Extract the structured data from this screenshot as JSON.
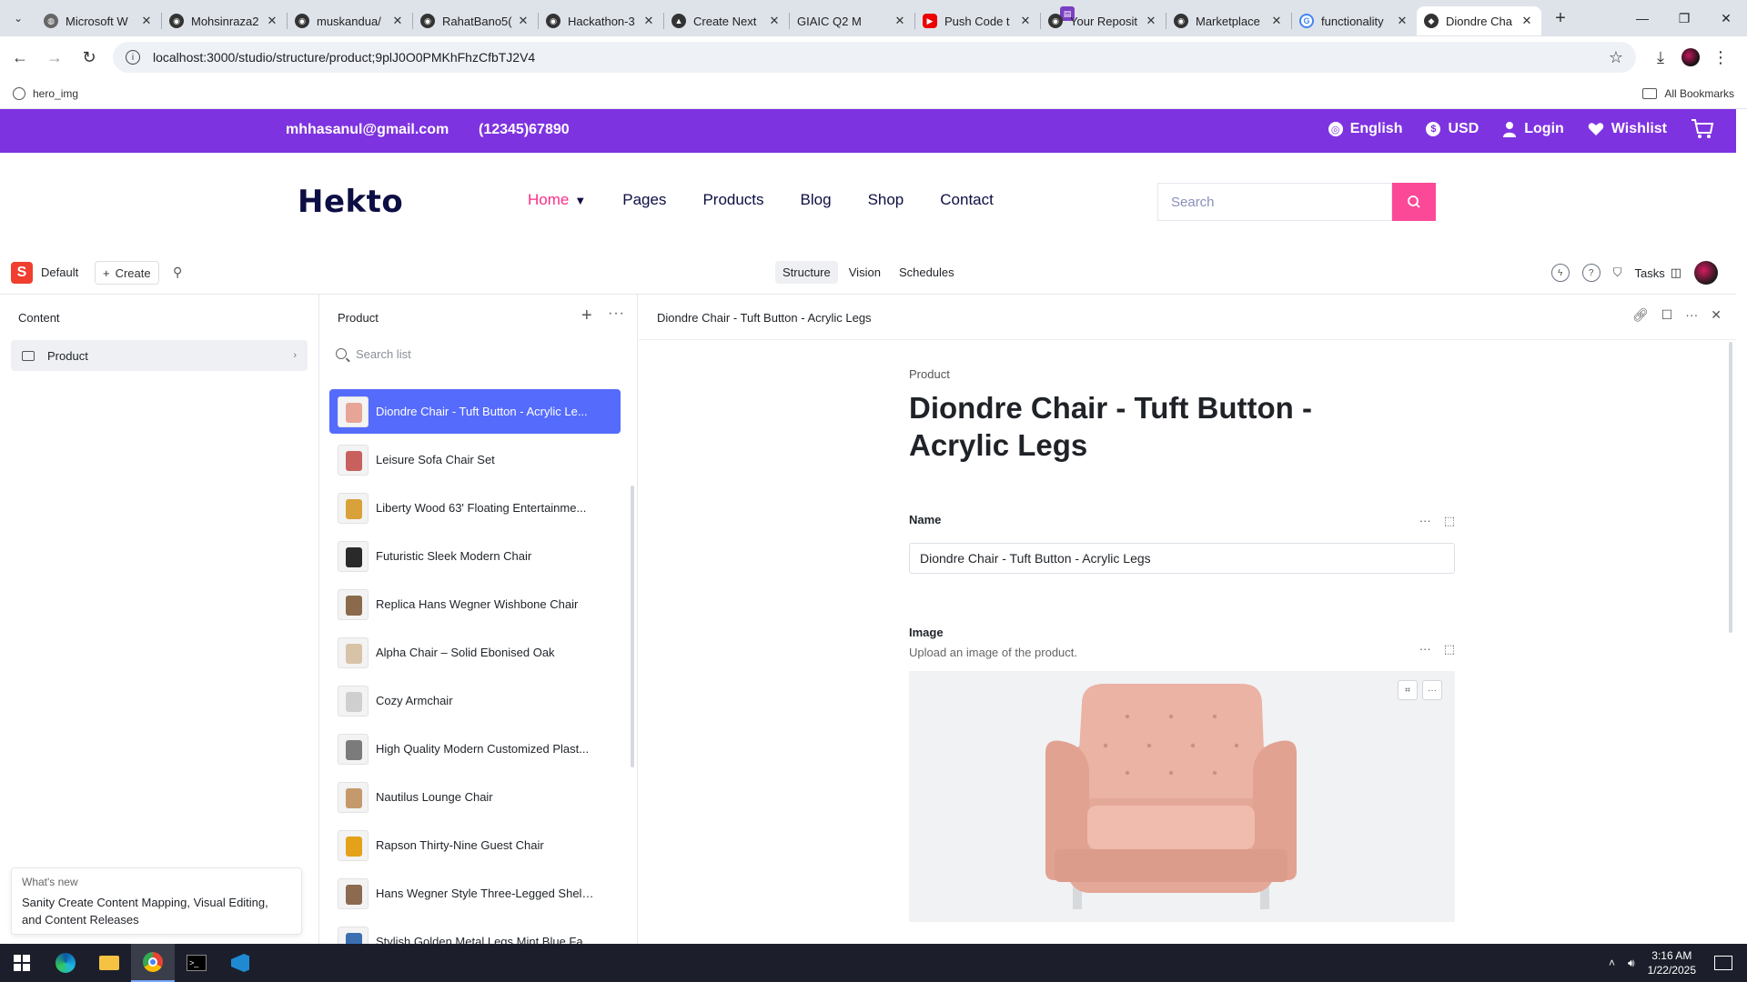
{
  "browser": {
    "tabs": [
      {
        "title": "Microsoft W",
        "icon": "microsoft-icon"
      },
      {
        "title": "Mohsinraza2",
        "icon": "github-icon"
      },
      {
        "title": "muskandua/",
        "icon": "github-icon"
      },
      {
        "title": "RahatBano5(",
        "icon": "github-icon"
      },
      {
        "title": "Hackathon-3",
        "icon": "github-icon"
      },
      {
        "title": "Create Next",
        "icon": "nextjs-icon"
      },
      {
        "title": "GIAIC Q2 M",
        "icon": "doc-icon"
      },
      {
        "title": "Push Code t",
        "icon": "youtube-icon"
      },
      {
        "title": "Your Reposit",
        "icon": "github-icon"
      },
      {
        "title": "Marketplace",
        "icon": "github-icon"
      },
      {
        "title": "functionality",
        "icon": "google-icon"
      },
      {
        "title": "Diondre Cha",
        "icon": "sanity-icon",
        "active": true
      }
    ],
    "url": "localhost:3000/studio/structure/product;9plJ0O0PMKhFhzCfbTJ2V4",
    "bookmark": "hero_img",
    "all_bookmarks": "All Bookmarks"
  },
  "site": {
    "email": "mhhasanul@gmail.com",
    "phone": "(12345)67890",
    "language": "English",
    "currency": "USD",
    "login": "Login",
    "wishlist": "Wishlist",
    "logo": "Hekto",
    "nav": {
      "home": "Home",
      "pages": "Pages",
      "products": "Products",
      "blog": "Blog",
      "shop": "Shop",
      "contact": "Contact"
    },
    "search_placeholder": "Search",
    "accent": "#7E33E0",
    "pink": "#FB2E86"
  },
  "studio": {
    "workspace": "Default",
    "create": "Create",
    "tabs": {
      "structure": "Structure",
      "vision": "Vision",
      "schedules": "Schedules"
    },
    "tasks": "Tasks",
    "content_title": "Content",
    "content_item": "Product",
    "list_title": "Product",
    "list_search": "Search list",
    "list": [
      "Diondre Chair - Tuft Button - Acrylic Le...",
      "Leisure Sofa Chair Set",
      "Liberty Wood 63' Floating Entertainme...",
      "Futuristic Sleek Modern Chair",
      "Replica Hans Wegner Wishbone Chair",
      "Alpha Chair – Solid Ebonised Oak",
      "Cozy Armchair",
      "High Quality Modern Customized Plast...",
      "Nautilus Lounge Chair",
      "Rapson Thirty-Nine Guest Chair",
      "Hans Wegner Style Three-Legged Shell...",
      "Stylish Golden Metal Legs Mint Blue Fa..."
    ],
    "doc_header": "Diondre Chair - Tuft Button - Acrylic Legs",
    "doc_type": "Product",
    "doc_title": "Diondre Chair - Tuft Button - Acrylic Legs",
    "name_label": "Name",
    "name_value": "Diondre Chair - Tuft Button - Acrylic Legs",
    "image_label": "Image",
    "image_desc": "Upload an image of the product.",
    "whats_new_title": "What's new",
    "whats_new_body": "Sanity Create Content Mapping, Visual Editing, and Content Releases",
    "selected_color": "#556BFC"
  },
  "taskbar": {
    "time": "3:16 AM",
    "date": "1/22/2025"
  }
}
